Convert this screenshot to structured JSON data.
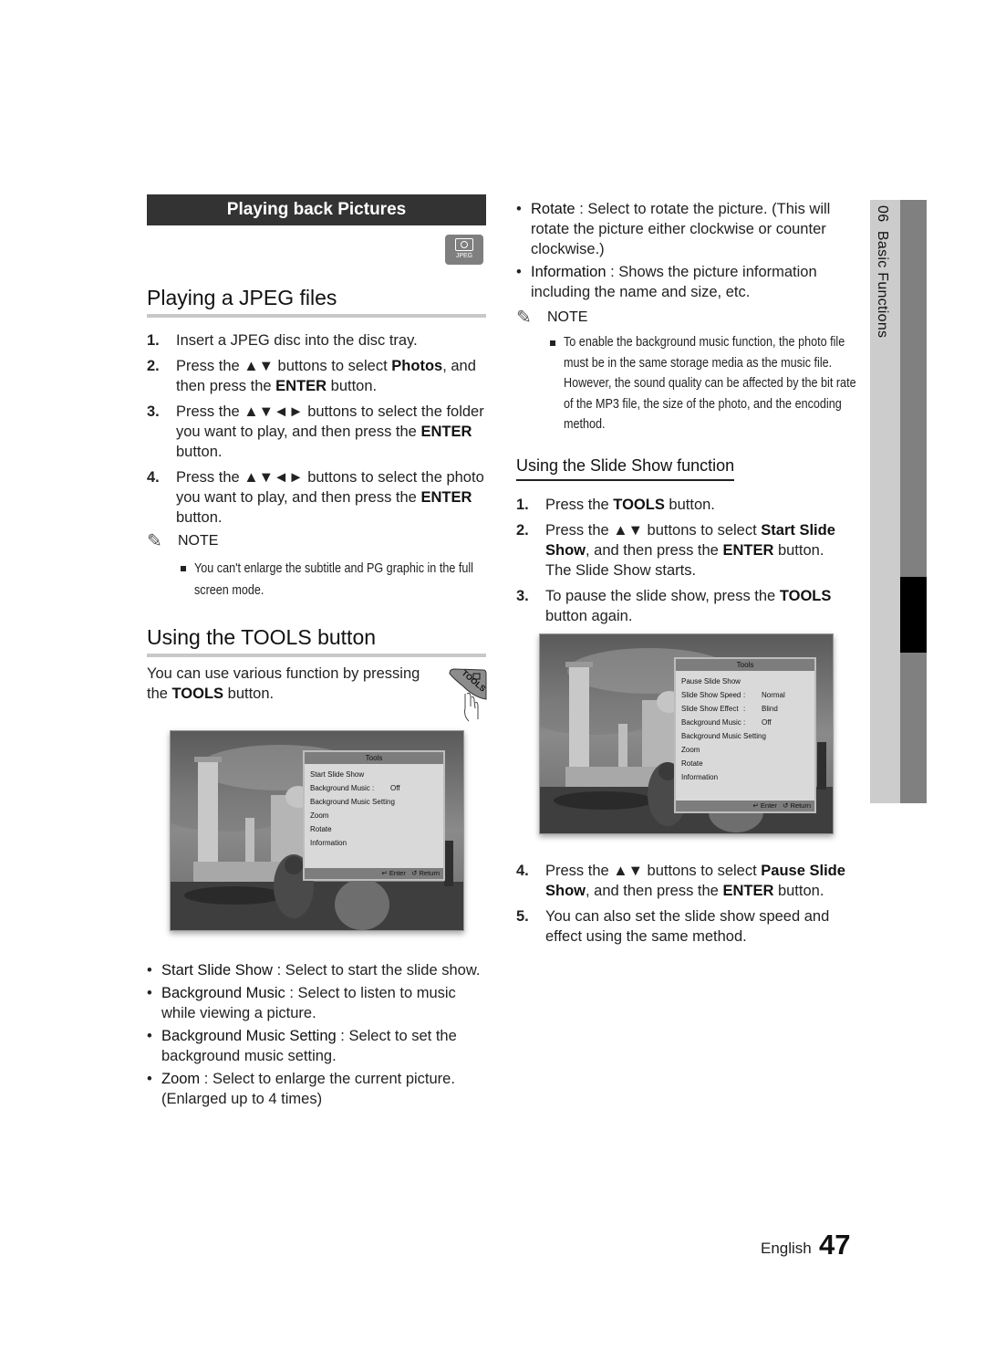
{
  "section_banner": "Playing back Pictures",
  "jpeg_badge": {
    "icon": "camera-icon",
    "label": "JPEG"
  },
  "jpeg_section": {
    "title": "Playing a JPEG files",
    "steps": [
      {
        "num": "1.",
        "parts": [
          {
            "t": "Insert a JPEG disc into the disc tray."
          }
        ]
      },
      {
        "num": "2.",
        "parts": [
          {
            "t": "Press the ▲▼ buttons to select "
          },
          {
            "b": "Photos"
          },
          {
            "t": ", and then press the "
          },
          {
            "b": "ENTER"
          },
          {
            "t": " button."
          }
        ]
      },
      {
        "num": "3.",
        "parts": [
          {
            "t": "Press the ▲▼◄► buttons to select the folder you want to play, and then press the "
          },
          {
            "b": "ENTER"
          },
          {
            "t": " button."
          }
        ]
      },
      {
        "num": "4.",
        "parts": [
          {
            "t": "Press the ▲▼◄► buttons to select the photo you want to play, and then press the "
          },
          {
            "b": "ENTER"
          },
          {
            "t": " button."
          }
        ]
      }
    ],
    "note_label": "NOTE",
    "note_text": "You can't enlarge the subtitle and PG graphic in the full screen mode."
  },
  "tools_section": {
    "title": "Using the TOOLS button",
    "intro_parts": [
      {
        "t": "You can use various function by pressing the "
      },
      {
        "b": "TOOLS"
      },
      {
        "t": " button."
      }
    ],
    "remote_icon_label": "TOOLS",
    "menu": {
      "title": "Tools",
      "items": [
        {
          "label": "Start Slide Show",
          "value": ""
        },
        {
          "label": "Background Music",
          "value": "Off"
        },
        {
          "label": "Background Music Setting",
          "value": ""
        },
        {
          "label": "Zoom",
          "value": ""
        },
        {
          "label": "Rotate",
          "value": ""
        },
        {
          "label": "Information",
          "value": ""
        }
      ],
      "footer_enter": "Enter",
      "footer_return": "Return"
    },
    "bullets": [
      {
        "term": "Start Slide Show",
        "desc": " : Select to start the slide show."
      },
      {
        "term": "Background Music",
        "desc": " : Select to listen to music while viewing a picture."
      },
      {
        "term": "Background Music Setting",
        "desc": " : Select to set the background music setting."
      },
      {
        "term": "Zoom",
        "desc": " : Select to enlarge the current picture. (Enlarged up to 4 times)"
      },
      {
        "term": "Rotate",
        "desc": " : Select to rotate the picture. (This will rotate the picture either clockwise or counter clockwise.)"
      },
      {
        "term": "Information",
        "desc": " : Shows the picture information including the name and size, etc."
      }
    ],
    "note_label": "NOTE",
    "note_text": "To enable the background music function, the photo file must be in the same storage media as the music file. However, the sound quality can be affected by the bit rate of the MP3 file, the size of the photo, and the encoding method."
  },
  "slideshow_section": {
    "title": "Using the Slide Show function",
    "steps_a": [
      {
        "num": "1.",
        "parts": [
          {
            "t": "Press the "
          },
          {
            "b": "TOOLS"
          },
          {
            "t": " button."
          }
        ]
      },
      {
        "num": "2.",
        "parts": [
          {
            "t": "Press the ▲▼ buttons to select "
          },
          {
            "b": "Start Slide Show"
          },
          {
            "t": ", and then press the "
          },
          {
            "b": "ENTER"
          },
          {
            "t": " button. The Slide Show starts."
          }
        ]
      },
      {
        "num": "3.",
        "parts": [
          {
            "t": "To pause the slide show, press the "
          },
          {
            "b": "TOOLS"
          },
          {
            "t": " button again."
          }
        ]
      }
    ],
    "menu": {
      "title": "Tools",
      "items": [
        {
          "label": "Pause Slide Show",
          "value": ""
        },
        {
          "label": "Slide Show Speed",
          "value": "Normal"
        },
        {
          "label": "Slide Show Effect",
          "value": "Blind"
        },
        {
          "label": "Background Music",
          "value": "Off"
        },
        {
          "label": "Background Music Setting",
          "value": ""
        },
        {
          "label": "Zoom",
          "value": ""
        },
        {
          "label": "Rotate",
          "value": ""
        },
        {
          "label": "Information",
          "value": ""
        }
      ],
      "footer_enter": "Enter",
      "footer_return": "Return"
    },
    "steps_b": [
      {
        "num": "4.",
        "parts": [
          {
            "t": "Press the ▲▼ buttons to select "
          },
          {
            "b": "Pause Slide Show"
          },
          {
            "t": ", and then press the "
          },
          {
            "b": "ENTER"
          },
          {
            "t": " button."
          }
        ]
      },
      {
        "num": "5.",
        "parts": [
          {
            "t": "You can also set the slide show speed and effect using the same method."
          }
        ]
      }
    ]
  },
  "side_tab": {
    "chapter": "06",
    "label": "Basic Functions"
  },
  "footer": {
    "language": "English",
    "page_number": "47"
  }
}
